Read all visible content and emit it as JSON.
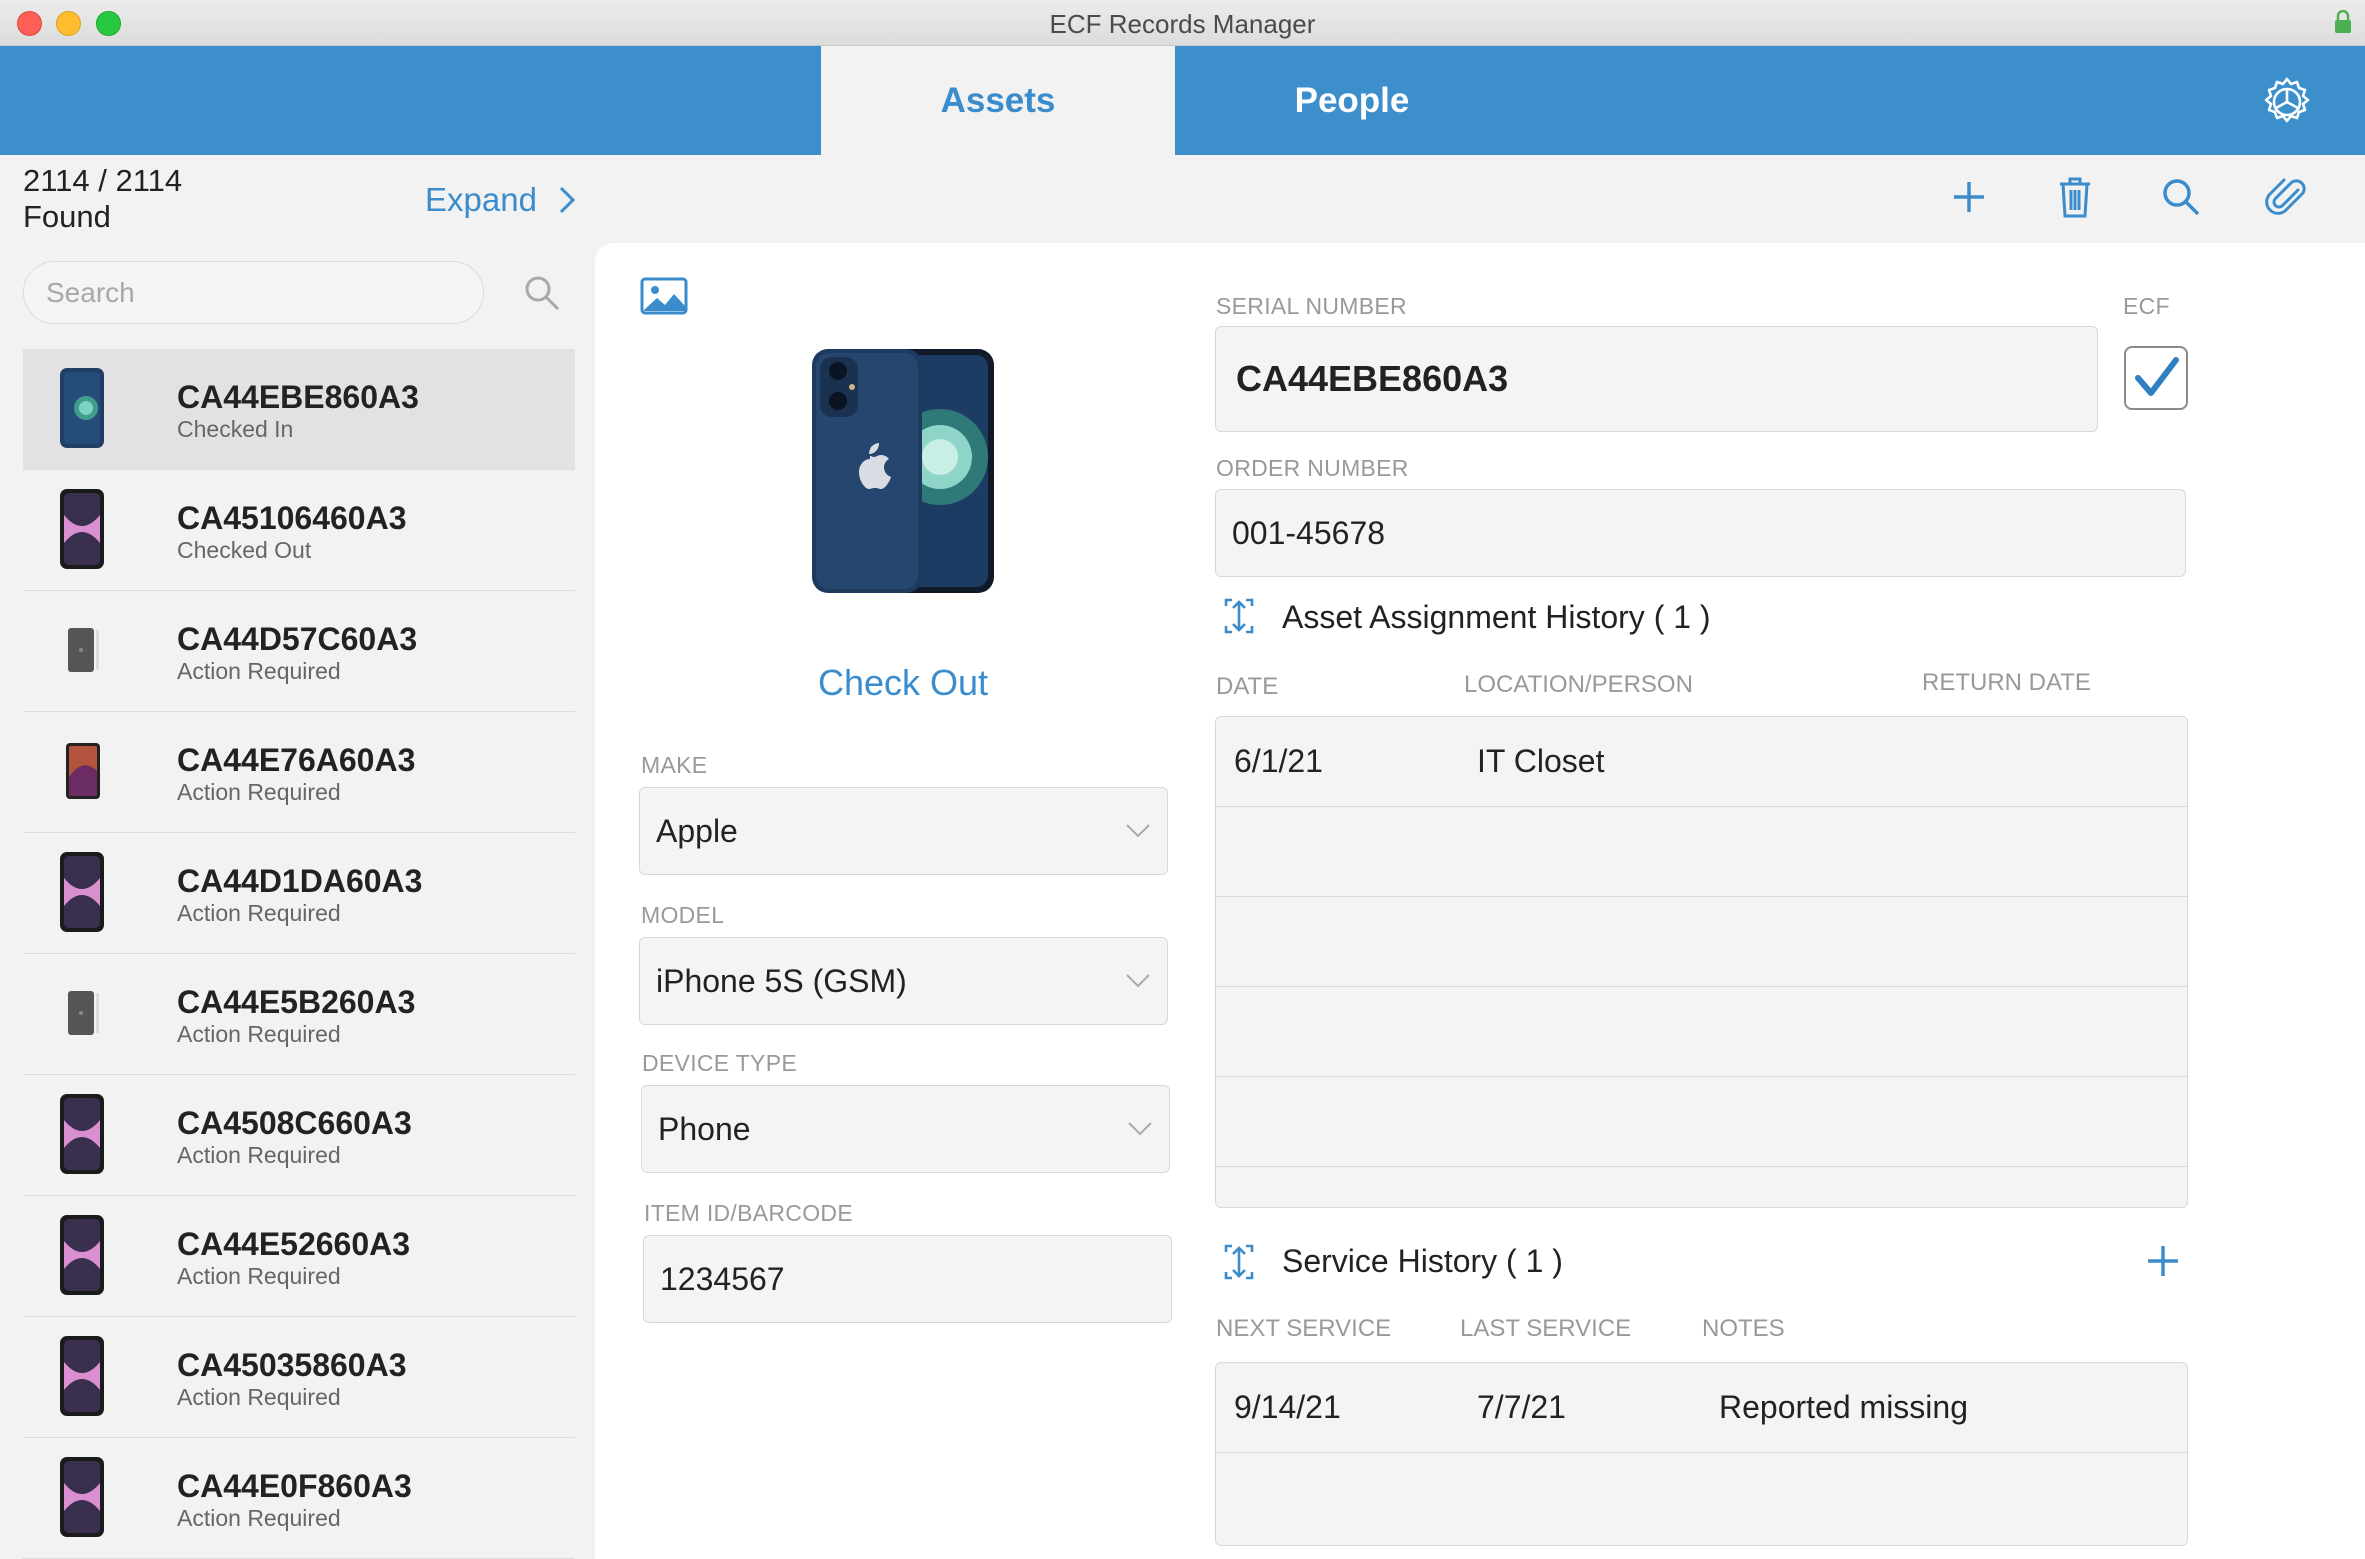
{
  "window": {
    "title": "ECF Records Manager"
  },
  "nav": {
    "tabs": [
      {
        "label": "Assets"
      },
      {
        "label": "People"
      }
    ]
  },
  "toolbar": {
    "found_count": "2114 / 2114",
    "found_label": "Found",
    "expand_label": "Expand"
  },
  "sidebar": {
    "search_placeholder": "Search",
    "items": [
      {
        "serial": "CA44EBE860A3",
        "status": "Checked In",
        "thumb": "iphone-12-blue"
      },
      {
        "serial": "CA45106460A3",
        "status": "Checked Out",
        "thumb": "iphone-11-purple"
      },
      {
        "serial": "CA44D57C60A3",
        "status": "Action Required",
        "thumb": "ipod-gray"
      },
      {
        "serial": "CA44E76A60A3",
        "status": "Action Required",
        "thumb": "ipad-dark"
      },
      {
        "serial": "CA44D1DA60A3",
        "status": "Action Required",
        "thumb": "iphone-11-purple"
      },
      {
        "serial": "CA44E5B260A3",
        "status": "Action Required",
        "thumb": "ipod-gray"
      },
      {
        "serial": "CA4508C660A3",
        "status": "Action Required",
        "thumb": "iphone-11-purple"
      },
      {
        "serial": "CA44E52660A3",
        "status": "Action Required",
        "thumb": "iphone-11-purple"
      },
      {
        "serial": "CA45035860A3",
        "status": "Action Required",
        "thumb": "iphone-11-purple"
      },
      {
        "serial": "CA44E0F860A3",
        "status": "Action Required",
        "thumb": "iphone-11-purple"
      }
    ]
  },
  "detail": {
    "checkout_label": "Check Out",
    "make": {
      "label": "MAKE",
      "value": "Apple"
    },
    "model": {
      "label": "MODEL",
      "value": "iPhone 5S (GSM)"
    },
    "device_type": {
      "label": "DEVICE TYPE",
      "value": "Phone"
    },
    "item_id": {
      "label": "ITEM ID/BARCODE",
      "value": "1234567"
    },
    "serial": {
      "label": "SERIAL NUMBER",
      "value": "CA44EBE860A3"
    },
    "ecf": {
      "label": "ECF",
      "checked": true
    },
    "order": {
      "label": "ORDER NUMBER",
      "value": "001-45678"
    },
    "assignment": {
      "title": "Asset Assignment History ( 1 )",
      "columns": [
        "DATE",
        "LOCATION/PERSON",
        "RETURN DATE"
      ],
      "rows": [
        [
          "6/1/21",
          "IT Closet",
          ""
        ],
        [
          "",
          "",
          ""
        ],
        [
          "",
          "",
          ""
        ],
        [
          "",
          "",
          ""
        ],
        [
          "",
          "",
          ""
        ]
      ]
    },
    "service": {
      "title": "Service History ( 1 )",
      "columns": [
        "NEXT SERVICE",
        "LAST SERVICE",
        "NOTES"
      ],
      "rows": [
        [
          "9/14/21",
          "7/7/21",
          "Reported missing"
        ],
        [
          "",
          "",
          ""
        ]
      ]
    }
  },
  "colors": {
    "accent": "#3d8fcc",
    "link": "#3a8ccc",
    "panel": "#ffffff",
    "background": "#f2f2f2"
  }
}
